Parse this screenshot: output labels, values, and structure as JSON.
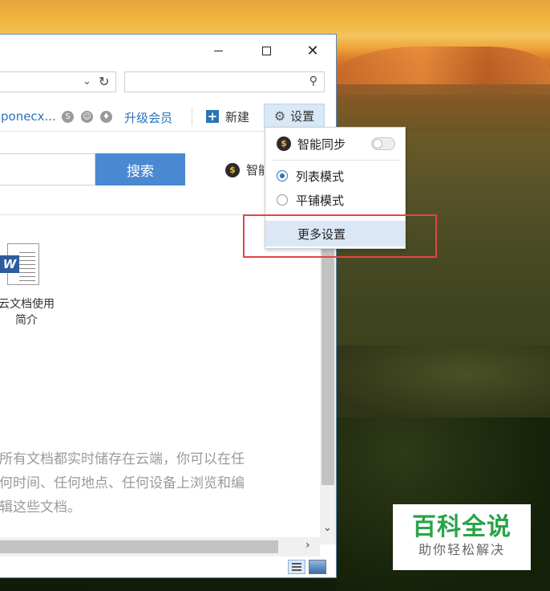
{
  "window": {
    "minimize_glyph": "—",
    "maximize_glyph": "☐",
    "close_glyph": "✕"
  },
  "address_bar": {
    "value": "",
    "dropdown_icon": "chevron-down-icon",
    "refresh_icon": "refresh-icon"
  },
  "search_bar": {
    "value": "",
    "icon": "search-icon"
  },
  "toolbar": {
    "username": "poneсx...",
    "badges": [
      "S",
      "☺",
      "♦"
    ],
    "upgrade_label": "升级会员",
    "new_label": "新建",
    "settings_label": "设置"
  },
  "search": {
    "input_value": "",
    "button_label": "搜索",
    "smart_tag": "智能"
  },
  "file": {
    "icon_letter": "W",
    "name": "云文档使用\n简介"
  },
  "description": "所有文档都实时储存在云端，你可以在任何时间、任何地点、任何设备上浏览和编辑这些文档。",
  "description_visible": "所有文档都实时储存在云端，你可以在任\n何时间、任何地点、任何设备上浏览和编\n辑这些文档。",
  "settings_menu": {
    "smart_sync_label": "智能同步",
    "smart_sync_on": false,
    "list_mode_label": "列表模式",
    "tile_mode_label": "平铺模式",
    "selected_mode": "列表模式",
    "more_settings_label": "更多设置"
  },
  "watermark": {
    "title": "百科全说",
    "subtitle": "助你轻松解决"
  },
  "colors": {
    "accent": "#2c73b8",
    "search_button": "#4a89d2",
    "highlight": "#e04646",
    "watermark_green": "#2aa34a"
  }
}
